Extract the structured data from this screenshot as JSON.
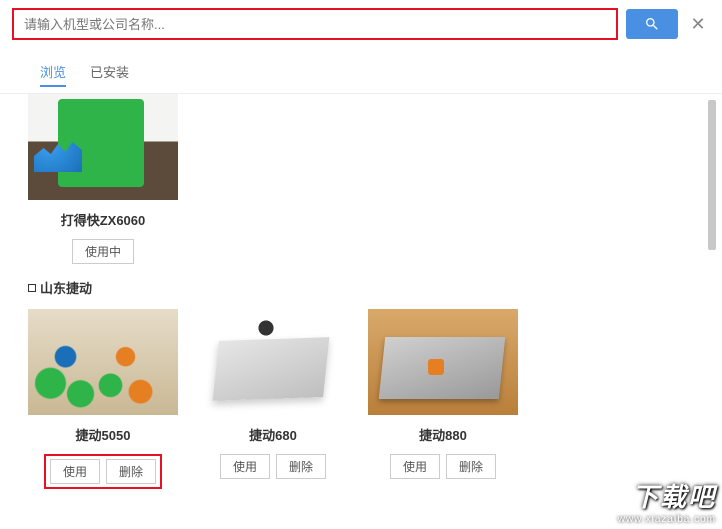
{
  "search": {
    "placeholder": "请输入机型或公司名称..."
  },
  "tabs": {
    "browse": "浏览",
    "installed": "已安装"
  },
  "top_card": {
    "title": "打得快ZX6060",
    "status_btn": "使用中"
  },
  "section": {
    "title": "山东捷动"
  },
  "cards": [
    {
      "title": "捷动5050",
      "use": "使用",
      "delete": "删除"
    },
    {
      "title": "捷动680",
      "use": "使用",
      "delete": "删除"
    },
    {
      "title": "捷动880",
      "use": "使用",
      "delete": "删除"
    }
  ],
  "watermark": {
    "big": "下载吧",
    "small": "www.xiazaiba.com"
  }
}
